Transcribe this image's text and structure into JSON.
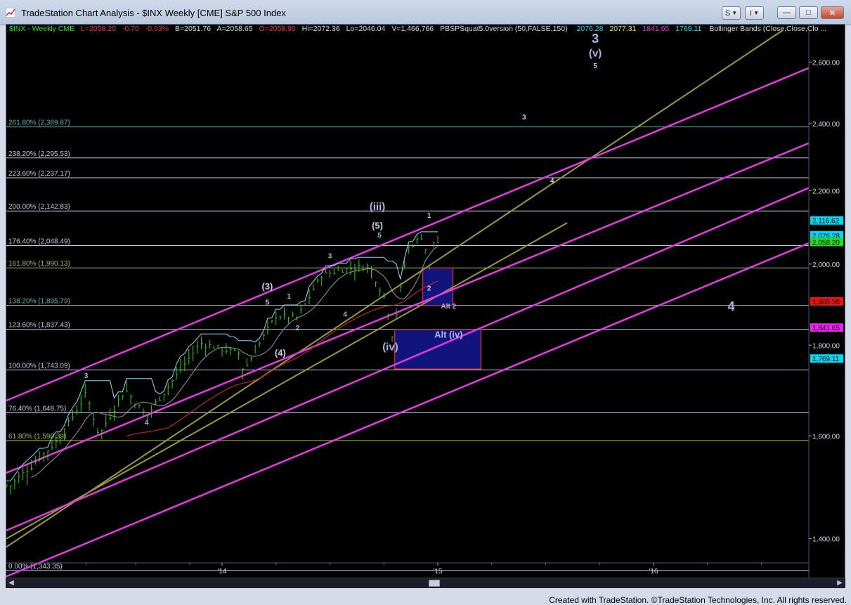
{
  "window": {
    "title": "TradeStation Chart Analysis - $INX Weekly [CME] S&P 500 Index",
    "s_button": "S",
    "i_button": "I",
    "minimize_label": "—",
    "maximize_label": "□",
    "close_label": "✕"
  },
  "header": {
    "symbol": "$INX - Weekly  CME",
    "last": "L=2058.20",
    "change": "-0.70",
    "change_pct": "-0.03%",
    "bid": "B=2051.76",
    "ask": "A=2058.65",
    "open": "O=2058.90",
    "high": "Hi=2072.36",
    "low": "Lo=2046.04",
    "volume": "V=1,466,766",
    "indicator": "PBSPSquat5.0version (50,FALSE,150)",
    "ind_v1": "2076.28",
    "ind_v2": "2077.31",
    "ind_v3": "1841.65",
    "ind_v4": "1769.11",
    "bollinger": "Bollinger Bands (Close,Close,Clo ..."
  },
  "colors": {
    "background": "#000000",
    "price_bars": "#2bd20a",
    "channel_magenta": "#e33be0",
    "channel_olive": "#9a9a3a",
    "fib_lines": "#c5cbe8",
    "wave_labels": "#a9b9e6",
    "box_fill": "#12147e",
    "box_border": "#c0302a"
  },
  "fib_levels": [
    {
      "label": "261.80% (2,389.87)",
      "value": 2389.87,
      "color": "#5fb2b2"
    },
    {
      "label": "238.20% (2,295.53)",
      "value": 2295.53,
      "color": "#c5cbe8"
    },
    {
      "label": "223.60% (2,237.17)",
      "value": 2237.17,
      "color": "#c5cbe8"
    },
    {
      "label": "200.00% (2,142.83)",
      "value": 2142.83,
      "color": "#c5cbe8"
    },
    {
      "label": "176.40% (2,048.49)",
      "value": 2048.49,
      "color": "#c5cbe8"
    },
    {
      "label": "161.80% (1,990.13)",
      "value": 1990.13,
      "color": "#b4b45a"
    },
    {
      "label": "138.20% (1,895.79)",
      "value": 1895.79,
      "color": "#5fb2b2"
    },
    {
      "label": "123.60% (1,837.43)",
      "value": 1837.43,
      "color": "#c5cbe8"
    },
    {
      "label": "100.00% (1,743.09)",
      "value": 1743.09,
      "color": "#c5cbe8"
    },
    {
      "label": "76.40% (1,648.75)",
      "value": 1648.75,
      "color": "#c5cbe8"
    },
    {
      "label": "61.80% (1,590.39)",
      "value": 1590.39,
      "color": "#b4b45a"
    },
    {
      "label": "0.00% (1,343.35)",
      "value": 1343.35,
      "color": "#c5cbe8"
    }
  ],
  "price_axis": {
    "ticks": [
      "2,600.00",
      "2,400.00",
      "2,200.00",
      "2,000.00",
      "1,800.00",
      "1,600.00",
      "1,400.00"
    ],
    "tick_values": [
      2600,
      2400,
      2200,
      2000,
      1800,
      1600,
      1400
    ],
    "tags": [
      {
        "label": "2,116.62",
        "value": 2116.62,
        "bg": "#00d8f0",
        "fg": "#000000"
      },
      {
        "label": "2,076.28",
        "value": 2076.28,
        "bg": "#00d8f0",
        "fg": "#000000"
      },
      {
        "label": "2,058.20",
        "value": 2058.2,
        "bg": "#22dd22",
        "fg": "#000000"
      },
      {
        "label": "1,905.36",
        "value": 1905.36,
        "bg": "#ee1111",
        "fg": "#000000"
      },
      {
        "label": "1,841.65",
        "value": 1841.65,
        "bg": "#ee22ee",
        "fg": "#000000"
      },
      {
        "label": "1,769.11",
        "value": 1769.11,
        "bg": "#00d8f0",
        "fg": "#000000"
      }
    ]
  },
  "time_axis": {
    "ticks": [
      "'14",
      "'15",
      "'16"
    ]
  },
  "wave_labels": [
    {
      "text": "3",
      "date": "2013.37",
      "price": 1725,
      "size": "sm",
      "color": "#a9b9e6"
    },
    {
      "text": "4",
      "date": "2013.65",
      "price": 1623,
      "size": "sm",
      "color": "#a9b9e6"
    },
    {
      "text": "(3)",
      "date": "2014.21",
      "price": 1935,
      "size": "md",
      "color": "#c5cbe8"
    },
    {
      "text": "5",
      "date": "2014.21",
      "price": 1897,
      "size": "sm",
      "color": "#c5cbe8"
    },
    {
      "text": "1",
      "date": "2014.31",
      "price": 1912,
      "size": "sm",
      "color": "#6fd0d0"
    },
    {
      "text": "2",
      "date": "2014.35",
      "price": 1835,
      "size": "sm",
      "color": "#6fd0d0"
    },
    {
      "text": "(4)",
      "date": "2014.27",
      "price": 1775,
      "size": "md",
      "color": "#c5cbe8"
    },
    {
      "text": "3",
      "date": "2014.50",
      "price": 2015,
      "size": "sm",
      "color": "#6fd0d0"
    },
    {
      "text": "4",
      "date": "2014.57",
      "price": 1868,
      "size": "sm",
      "color": "#6fd0d0"
    },
    {
      "text": "(iii)",
      "date": "2014.72",
      "price": 2145,
      "size": "lg",
      "color": "#a9b9e6"
    },
    {
      "text": "(5)",
      "date": "2014.72",
      "price": 2094,
      "size": "md",
      "color": "#c5cbe8"
    },
    {
      "text": "5",
      "date": "2014.73",
      "price": 2070,
      "size": "sm",
      "color": "#6fd0d0"
    },
    {
      "text": "(iv)",
      "date": "2014.78",
      "price": 1788,
      "size": "lg",
      "color": "#a9b9e6"
    },
    {
      "text": "1",
      "date": "2014.96",
      "price": 2124,
      "size": "sm",
      "color": "#c5cbe8"
    },
    {
      "text": "2",
      "date": "2014.96",
      "price": 1932,
      "size": "sm",
      "color": "#c5cbe8"
    },
    {
      "text": "Alt 2",
      "date": "2015.05",
      "price": 1888,
      "size": "sm",
      "color": "#a9b9e6"
    },
    {
      "text": "Alt (iv)",
      "date": "2015.05",
      "price": 1818,
      "size": "md",
      "color": "#a9b9e6"
    },
    {
      "text": "3",
      "date": "2015.40",
      "price": 2413,
      "size": "sm",
      "color": "#c5cbe8"
    },
    {
      "text": "4",
      "date": "2015.53",
      "price": 2222,
      "size": "sm",
      "color": "#c5cbe8"
    },
    {
      "text": "3",
      "date": "2015.73",
      "price": 2665,
      "size": "xl",
      "color": "#a9b9e6"
    },
    {
      "text": "(v)",
      "date": "2015.73",
      "price": 2618,
      "size": "lg",
      "color": "#a9b9e6"
    },
    {
      "text": "5",
      "date": "2015.73",
      "price": 2580,
      "size": "sm",
      "color": "#c5cbe8"
    },
    {
      "text": "4",
      "date": "2016.36",
      "price": 1883,
      "size": "xl",
      "color": "#a9b9e6"
    }
  ],
  "chart_data": {
    "type": "ohlc",
    "title": "$INX Weekly [CME] S&P 500 Index",
    "interval": "weekly",
    "x_range": [
      "2013.00",
      "2016.72"
    ],
    "y_range": [
      1325,
      2690
    ],
    "scale": "log",
    "grid": "off",
    "legend": "none",
    "price_waypoints": [
      [
        "2013.02",
        1500
      ],
      [
        "2013.25",
        1595
      ],
      [
        "2013.37",
        1690
      ],
      [
        "2013.43",
        1600
      ],
      [
        "2013.55",
        1700
      ],
      [
        "2013.65",
        1640
      ],
      [
        "2013.90",
        1805
      ],
      [
        "2014.08",
        1780
      ],
      [
        "2014.10",
        1740
      ],
      [
        "2014.25",
        1870
      ],
      [
        "2014.35",
        1865
      ],
      [
        "2014.46",
        1970
      ],
      [
        "2014.55",
        1985
      ],
      [
        "2014.68",
        1995
      ],
      [
        "2014.76",
        1905
      ],
      [
        "2014.79",
        1820
      ],
      [
        "2014.86",
        2040
      ],
      [
        "2014.93",
        2075
      ],
      [
        "2014.96",
        1990
      ],
      [
        "2014.98",
        2058
      ]
    ],
    "price_bar_range": [
      "2013.00",
      "2015.00"
    ],
    "box_alt2": {
      "from": "2014.93",
      "to": "2015.07",
      "top": 1990,
      "bottom": 1895
    },
    "box_alt_iv": {
      "from": "2014.80",
      "to": "2015.20",
      "top": 1837,
      "bottom": 1745
    },
    "channels_magenta": [
      {
        "from": [
          "2013.00",
          1675
        ],
        "to": [
          "2016.72",
          2580
        ]
      },
      {
        "from": [
          "2013.00",
          1525
        ],
        "to": [
          "2016.72",
          2340
        ]
      },
      {
        "from": [
          "2013.00",
          1415
        ],
        "to": [
          "2016.72",
          2208
        ]
      },
      {
        "from": [
          "2013.00",
          1333
        ],
        "to": [
          "2016.72",
          2055
        ]
      }
    ],
    "channels_olive": [
      {
        "from": [
          "2013.00",
          1385
        ],
        "to": [
          "2016.60",
          2710
        ]
      },
      {
        "from": [
          "2013.00",
          1400
        ],
        "to": [
          "2015.60",
          2110
        ]
      }
    ],
    "moving_averages": [
      {
        "name": "MA fast",
        "color": "#9a9a9a",
        "from": [
          "2013.10",
          1500
        ]
      },
      {
        "name": "MA slow",
        "color": "#b52d22"
      }
    ],
    "bollinger_upper_color": "#7fe6ff"
  }
}
